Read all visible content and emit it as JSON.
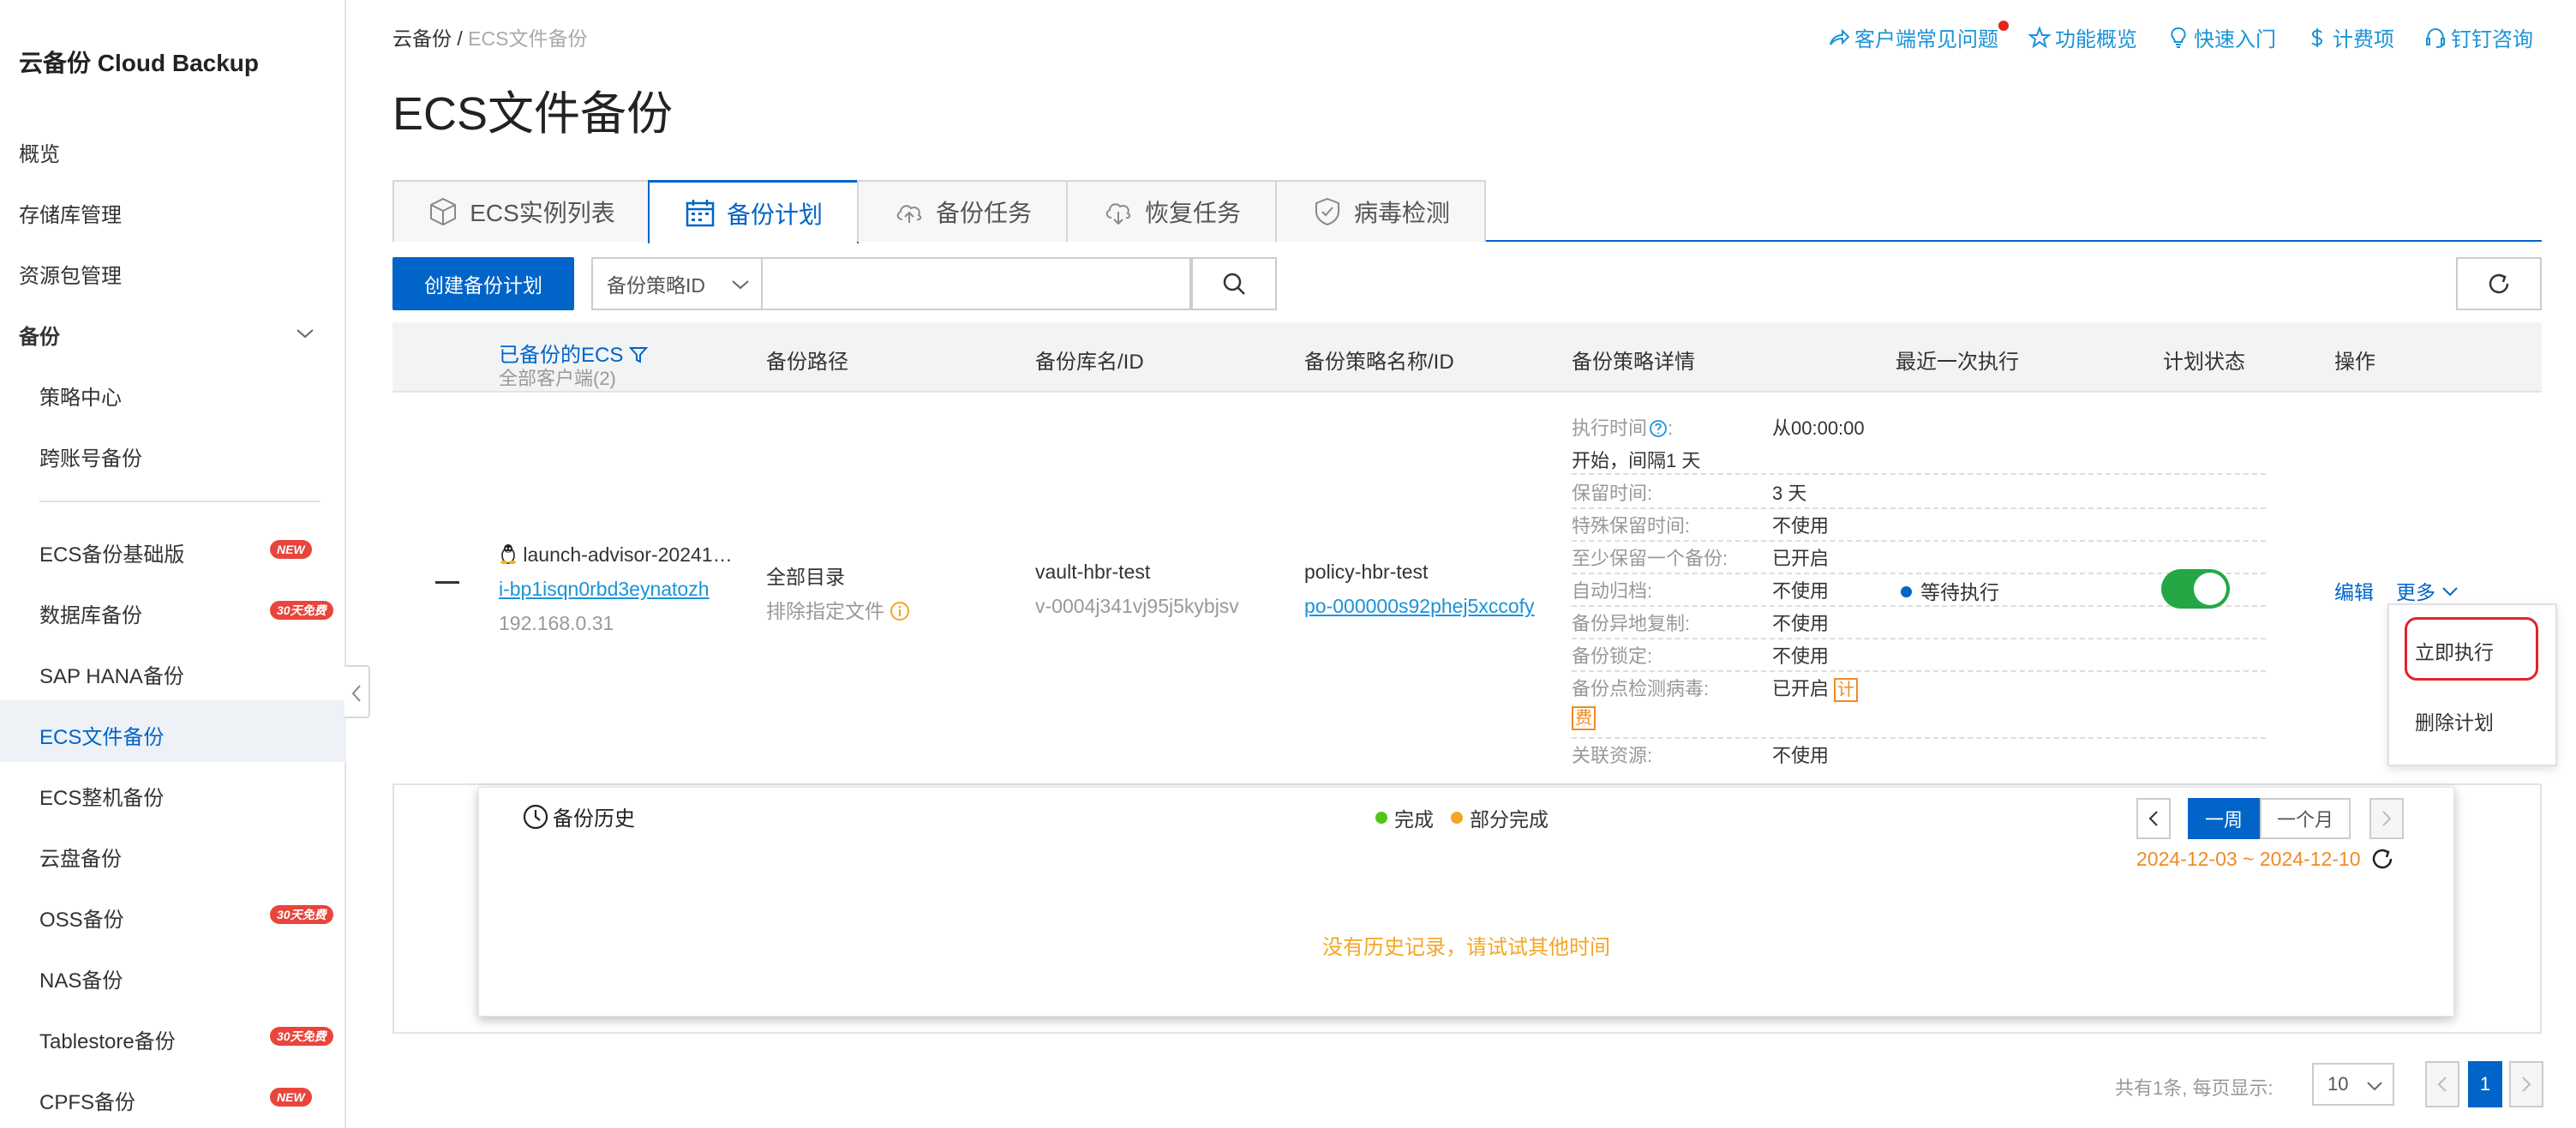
{
  "sidebar": {
    "title": "云备份 Cloud Backup",
    "items": [
      {
        "label": "概览"
      },
      {
        "label": "存储库管理"
      },
      {
        "label": "资源包管理"
      }
    ],
    "group": {
      "label": "备份"
    },
    "sub_items": [
      {
        "label": "策略中心"
      },
      {
        "label": "跨账号备份"
      }
    ],
    "products": [
      {
        "label": "ECS备份基础版",
        "badge": "NEW"
      },
      {
        "label": "数据库备份",
        "badge": "30天免费"
      },
      {
        "label": "SAP HANA备份",
        "badge": ""
      },
      {
        "label": "ECS文件备份",
        "badge": ""
      },
      {
        "label": "ECS整机备份",
        "badge": ""
      },
      {
        "label": "云盘备份",
        "badge": ""
      },
      {
        "label": "OSS备份",
        "badge": "30天免费"
      },
      {
        "label": "NAS备份",
        "badge": ""
      },
      {
        "label": "Tablestore备份",
        "badge": "30天免费"
      },
      {
        "label": "CPFS备份",
        "badge": "NEW"
      }
    ]
  },
  "breadcrumb": {
    "root": "云备份",
    "sep": "/",
    "current": "ECS文件备份"
  },
  "page_title": "ECS文件备份",
  "top_links": [
    "客户端常见问题",
    "功能概览",
    "快速入门",
    "计费项",
    "钉钉咨询"
  ],
  "tabs": [
    "ECS实例列表",
    "备份计划",
    "备份任务",
    "恢复任务",
    "病毒检测"
  ],
  "toolbar": {
    "create_label": "创建备份计划",
    "filter_select": "备份策略ID",
    "search_value": ""
  },
  "columns": {
    "ecs": "已备份的ECS",
    "ecs_sub": "全部客户端(2)",
    "path": "备份路径",
    "vault": "备份库名/ID",
    "policy": "备份策略名称/ID",
    "detail": "备份策略详情",
    "last_run": "最近一次执行",
    "plan_status": "计划状态",
    "ops": "操作"
  },
  "row": {
    "instance_name": "launch-advisor-20241…",
    "instance_id": "i-bp1isqn0rbd3eynatozh",
    "ip": "192.168.0.31",
    "path": "全部目录",
    "exclude": "排除指定文件",
    "vault_name": "vault-hbr-test",
    "vault_id": "v-0004j341vj95j5kybjsv",
    "policy_name": "policy-hbr-test",
    "policy_id": "po-000000s92phej5xccofy",
    "details": [
      {
        "k": "执行时间",
        "v": "从00:00:00"
      },
      {
        "k": "",
        "v": "开始，间隔1 天"
      },
      {
        "k": "保留时间:",
        "v": "3 天"
      },
      {
        "k": "特殊保留时间:",
        "v": "不使用"
      },
      {
        "k": "至少保留一个备份:",
        "v": "已开启"
      },
      {
        "k": "自动归档:",
        "v": "不使用"
      },
      {
        "k": "备份异地复制:",
        "v": "不使用"
      },
      {
        "k": "备份锁定:",
        "v": "不使用"
      },
      {
        "k": "备份点检测病毒:",
        "v": "已开启"
      },
      {
        "k": "关联资源:",
        "v": "不使用"
      }
    ],
    "fee_tag_1": "计",
    "fee_tag_2": "费",
    "last_run": "等待执行",
    "plan_enabled": true,
    "edit": "编辑",
    "more": "更多"
  },
  "history": {
    "title": "备份历史",
    "legend": [
      {
        "label": "完成",
        "color": "#52c41a"
      },
      {
        "label": "部分完成",
        "color": "#f5a623"
      }
    ],
    "range_week": "一周",
    "range_month": "一个月",
    "date_range": "2024-12-03 ~ 2024-12-10",
    "empty": "没有历史记录，请试试其他时间"
  },
  "dropdown": [
    "立即执行",
    "删除计划"
  ],
  "pagination": {
    "summary": "共有1条, 每页显示:",
    "page_size": "10",
    "current_page": "1"
  }
}
